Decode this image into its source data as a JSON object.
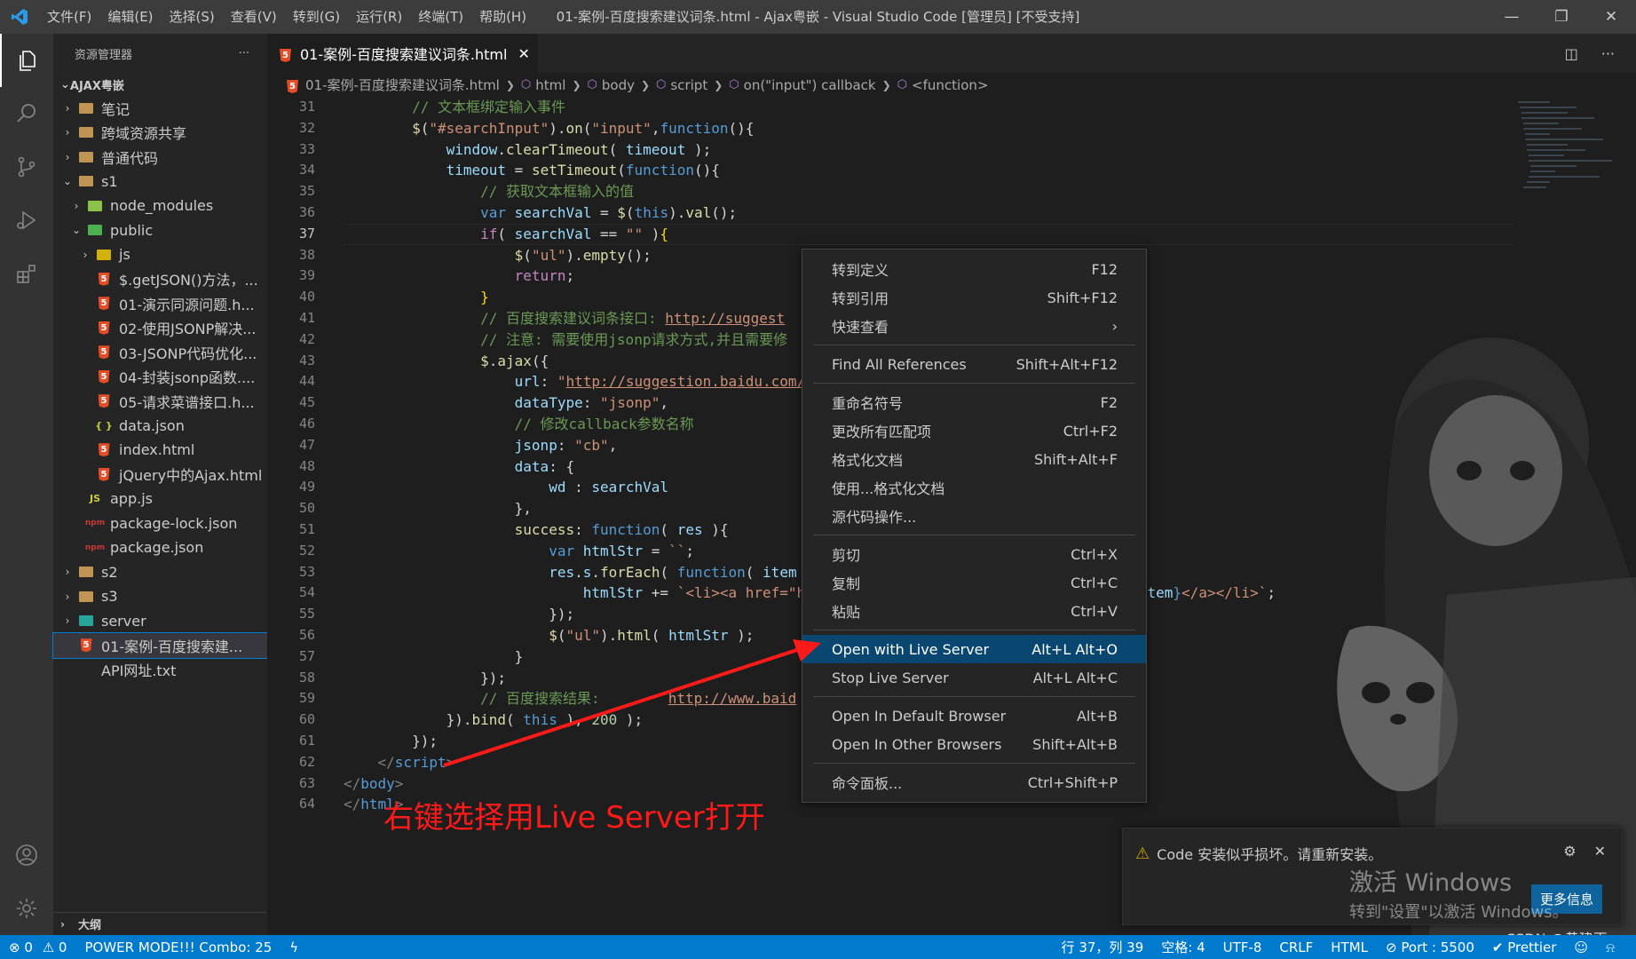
{
  "titlebar": {
    "menu": [
      "文件(F)",
      "编辑(E)",
      "选择(S)",
      "查看(V)",
      "转到(G)",
      "运行(R)",
      "终端(T)",
      "帮助(H)"
    ],
    "title": "01-案例-百度搜索建议词条.html - Ajax粤嵌 - Visual Studio Code [管理员] [不受支持]"
  },
  "sidebar": {
    "header": "资源管理器",
    "root": "AJAX粤嵌",
    "items": [
      {
        "label": "笔记",
        "type": "folder",
        "level": 1,
        "state": "closed"
      },
      {
        "label": "跨域资源共享",
        "type": "folder",
        "level": 1,
        "state": "closed"
      },
      {
        "label": "普通代码",
        "type": "folder",
        "level": 1,
        "state": "closed"
      },
      {
        "label": "s1",
        "type": "folder",
        "level": 1,
        "state": "open"
      },
      {
        "label": "node_modules",
        "type": "folder-node",
        "level": 2,
        "state": "closed"
      },
      {
        "label": "public",
        "type": "folder-public",
        "level": 2,
        "state": "open"
      },
      {
        "label": "js",
        "type": "folder-js",
        "level": 3,
        "state": "closed"
      },
      {
        "label": "$.getJSON()方法，...",
        "type": "html",
        "level": 3
      },
      {
        "label": "01-演示同源问题.h...",
        "type": "html",
        "level": 3
      },
      {
        "label": "02-使用JSONP解决...",
        "type": "html",
        "level": 3
      },
      {
        "label": "03-JSONP代码优化...",
        "type": "html",
        "level": 3
      },
      {
        "label": "04-封装jsonp函数....",
        "type": "html",
        "level": 3
      },
      {
        "label": "05-请求菜谱接口.h...",
        "type": "html",
        "level": 3
      },
      {
        "label": "data.json",
        "type": "json",
        "level": 3
      },
      {
        "label": "index.html",
        "type": "html",
        "level": 3
      },
      {
        "label": "jQuery中的Ajax.html",
        "type": "html",
        "level": 3
      },
      {
        "label": "app.js",
        "type": "js",
        "level": 2
      },
      {
        "label": "package-lock.json",
        "type": "npm",
        "level": 2
      },
      {
        "label": "package.json",
        "type": "npm",
        "level": 2
      },
      {
        "label": "s2",
        "type": "folder",
        "level": 1,
        "state": "closed"
      },
      {
        "label": "s3",
        "type": "folder",
        "level": 1,
        "state": "closed"
      },
      {
        "label": "server",
        "type": "folder-server",
        "level": 1,
        "state": "closed"
      },
      {
        "label": "01-案例-百度搜索建...",
        "type": "html",
        "level": 1,
        "selected": true
      },
      {
        "label": "API网址.txt",
        "type": "txt",
        "level": 1
      }
    ],
    "outline": "大纲"
  },
  "tab": {
    "label": "01-案例-百度搜索建议词条.html"
  },
  "breadcrumb": [
    "01-案例-百度搜索建议词条.html",
    "html",
    "body",
    "script",
    "on(\"input\") callback",
    "<function>"
  ],
  "editor": {
    "line_start": 31,
    "current_line": 37,
    "lines": [
      [
        [
          "c-com",
          "        // 文本框绑定输入事件"
        ]
      ],
      [
        [
          "",
          "        "
        ],
        [
          "c-fn",
          "$"
        ],
        [
          "",
          "("
        ],
        [
          "c-str",
          "\"#searchInput\""
        ],
        [
          "",
          ")."
        ],
        [
          "c-fn",
          "on"
        ],
        [
          "",
          "("
        ],
        [
          "c-str",
          "\"input\""
        ],
        [
          "",
          ","
        ],
        [
          "c-kw",
          "function"
        ],
        [
          "",
          "(){"
        ]
      ],
      [
        [
          "",
          "            "
        ],
        [
          "c-var",
          "window"
        ],
        [
          "",
          "."
        ],
        [
          "c-fn",
          "clearTimeout"
        ],
        [
          "",
          "( "
        ],
        [
          "c-var",
          "timeout"
        ],
        [
          "",
          " );"
        ]
      ],
      [
        [
          "",
          "            "
        ],
        [
          "c-var",
          "timeout"
        ],
        [
          "",
          " = "
        ],
        [
          "c-fn",
          "setTimeout"
        ],
        [
          "",
          "("
        ],
        [
          "c-kw",
          "function"
        ],
        [
          "",
          "(){"
        ]
      ],
      [
        [
          "c-com",
          "                // 获取文本框输入的值"
        ]
      ],
      [
        [
          "",
          "                "
        ],
        [
          "c-kw",
          "var"
        ],
        [
          "",
          " "
        ],
        [
          "c-var",
          "searchVal"
        ],
        [
          "",
          " = "
        ],
        [
          "c-fn",
          "$"
        ],
        [
          "",
          "("
        ],
        [
          "c-kw",
          "this"
        ],
        [
          "",
          ")."
        ],
        [
          "c-fn",
          "val"
        ],
        [
          "",
          "();"
        ]
      ],
      [
        [
          "",
          "                "
        ],
        [
          "c-ctl",
          "if"
        ],
        [
          "",
          "( "
        ],
        [
          "c-var",
          "searchVal"
        ],
        [
          "",
          " == "
        ],
        [
          "c-str",
          "\"\""
        ],
        [
          "",
          " )"
        ],
        [
          "c-br",
          "{"
        ]
      ],
      [
        [
          "",
          "                    "
        ],
        [
          "c-fn",
          "$"
        ],
        [
          "",
          "("
        ],
        [
          "c-str",
          "\"ul\""
        ],
        [
          "",
          ")."
        ],
        [
          "c-fn",
          "empty"
        ],
        [
          "",
          "();"
        ]
      ],
      [
        [
          "",
          "                    "
        ],
        [
          "c-ctl",
          "return"
        ],
        [
          "",
          ";"
        ]
      ],
      [
        [
          "",
          "                "
        ],
        [
          "c-br",
          "}"
        ]
      ],
      [
        [
          "c-com",
          "                // 百度搜索建议词条接口: "
        ],
        [
          "c-url",
          "http://suggest"
        ]
      ],
      [
        [
          "c-com",
          "                // 注意: 需要使用jsonp请求方式,并且需要修"
        ]
      ],
      [
        [
          "",
          "                "
        ],
        [
          "c-fn",
          "$"
        ],
        [
          "",
          "."
        ],
        [
          "c-fn",
          "ajax"
        ],
        [
          "",
          "({"
        ]
      ],
      [
        [
          "",
          "                    "
        ],
        [
          "c-var",
          "url"
        ],
        [
          "",
          ": "
        ],
        [
          "c-str",
          "\""
        ],
        [
          "c-url",
          "http://suggestion.baidu.com/"
        ]
      ],
      [
        [
          "",
          "                    "
        ],
        [
          "c-var",
          "dataType"
        ],
        [
          "",
          ": "
        ],
        [
          "c-str",
          "\"jsonp\""
        ],
        [
          "",
          ","
        ]
      ],
      [
        [
          "c-com",
          "                    // 修改callback参数名称"
        ]
      ],
      [
        [
          "",
          "                    "
        ],
        [
          "c-var",
          "jsonp"
        ],
        [
          "",
          ": "
        ],
        [
          "c-str",
          "\"cb\""
        ],
        [
          "",
          ","
        ]
      ],
      [
        [
          "",
          "                    "
        ],
        [
          "c-var",
          "data"
        ],
        [
          "",
          ": {"
        ]
      ],
      [
        [
          "",
          "                        "
        ],
        [
          "c-var",
          "wd"
        ],
        [
          "",
          " : "
        ],
        [
          "c-var",
          "searchVal"
        ]
      ],
      [
        [
          "",
          "                    },"
        ]
      ],
      [
        [
          "",
          "                    "
        ],
        [
          "c-fn",
          "success"
        ],
        [
          "",
          ": "
        ],
        [
          "c-kw",
          "function"
        ],
        [
          "",
          "( "
        ],
        [
          "c-var",
          "res"
        ],
        [
          "",
          " ){"
        ]
      ],
      [
        [
          "",
          "                        "
        ],
        [
          "c-kw",
          "var"
        ],
        [
          "",
          " "
        ],
        [
          "c-var",
          "htmlStr"
        ],
        [
          "",
          " = "
        ],
        [
          "c-str",
          "``"
        ],
        [
          "",
          ";"
        ]
      ],
      [
        [
          "",
          "                        "
        ],
        [
          "c-var",
          "res"
        ],
        [
          "",
          "."
        ],
        [
          "c-var",
          "s"
        ],
        [
          "",
          "."
        ],
        [
          "c-fn",
          "forEach"
        ],
        [
          "",
          "( "
        ],
        [
          "c-kw",
          "function"
        ],
        [
          "",
          "( "
        ],
        [
          "c-var",
          "item"
        ]
      ],
      [
        [
          "",
          "                            "
        ],
        [
          "c-var",
          "htmlStr"
        ],
        [
          "",
          " += "
        ],
        [
          "c-str",
          "`<li><a href=\"h"
        ],
        [
          "",
          "                          "
        ],
        [
          "c-str",
          "t=\"_blank\">"
        ],
        [
          "c-kw",
          "${"
        ],
        [
          "c-var",
          "item"
        ],
        [
          "c-kw",
          "}"
        ],
        [
          "c-str",
          "</a></li>`"
        ],
        [
          "",
          ";"
        ]
      ],
      [
        [
          "",
          "                        });"
        ]
      ],
      [
        [
          "",
          "                        "
        ],
        [
          "c-fn",
          "$"
        ],
        [
          "",
          "("
        ],
        [
          "c-str",
          "\"ul\""
        ],
        [
          "",
          ")."
        ],
        [
          "c-fn",
          "html"
        ],
        [
          "",
          "( "
        ],
        [
          "c-var",
          "htmlStr"
        ],
        [
          "",
          " );"
        ]
      ],
      [
        [
          "",
          "                    }"
        ]
      ],
      [
        [
          "",
          "                });"
        ]
      ],
      [
        [
          "c-com",
          "                // 百度搜索结果:        "
        ],
        [
          "c-url",
          "http://www.baid"
        ]
      ],
      [
        [
          "",
          "            })."
        ],
        [
          "c-fn",
          "bind"
        ],
        [
          "",
          "( "
        ],
        [
          "c-kw",
          "this"
        ],
        [
          "",
          " ), "
        ],
        [
          "c-num",
          "200"
        ],
        [
          "",
          " );"
        ]
      ],
      [
        [
          "",
          "        });"
        ]
      ],
      [
        [
          "",
          "    "
        ],
        [
          "c-gray",
          "</"
        ],
        [
          "c-tag",
          "script"
        ],
        [
          "c-gray",
          ">"
        ]
      ],
      [
        [
          "c-gray",
          "</"
        ],
        [
          "c-tag",
          "body"
        ],
        [
          "c-gray",
          ">"
        ]
      ],
      [
        [
          "c-gray",
          "</"
        ],
        [
          "c-tag",
          "html"
        ],
        [
          "c-gray",
          ">"
        ]
      ]
    ]
  },
  "context_menu": [
    {
      "label": "转到定义",
      "kb": "F12"
    },
    {
      "label": "转到引用",
      "kb": "Shift+F12"
    },
    {
      "label": "快速查看",
      "kb": "›"
    },
    {
      "sep": true
    },
    {
      "label": "Find All References",
      "kb": "Shift+Alt+F12"
    },
    {
      "sep": true
    },
    {
      "label": "重命名符号",
      "kb": "F2"
    },
    {
      "label": "更改所有匹配项",
      "kb": "Ctrl+F2"
    },
    {
      "label": "格式化文档",
      "kb": "Shift+Alt+F"
    },
    {
      "label": "使用...格式化文档",
      "kb": ""
    },
    {
      "label": "源代码操作...",
      "kb": ""
    },
    {
      "sep": true
    },
    {
      "label": "剪切",
      "kb": "Ctrl+X"
    },
    {
      "label": "复制",
      "kb": "Ctrl+C"
    },
    {
      "label": "粘贴",
      "kb": "Ctrl+V"
    },
    {
      "sep": true
    },
    {
      "label": "Open with Live Server",
      "kb": "Alt+L Alt+O",
      "active": true
    },
    {
      "label": "Stop Live Server",
      "kb": "Alt+L Alt+C"
    },
    {
      "sep": true
    },
    {
      "label": "Open In Default Browser",
      "kb": "Alt+B"
    },
    {
      "label": "Open In Other Browsers",
      "kb": "Shift+Alt+B"
    },
    {
      "sep": true
    },
    {
      "label": "命令面板...",
      "kb": "Ctrl+Shift+P"
    }
  ],
  "annotation": "右键选择用Live Server打开",
  "notification": {
    "message": "Code 安装似乎损坏。请重新安装。",
    "button": "更多信息"
  },
  "watermark": {
    "line1": "激活 Windows",
    "line2": "转到\"设置\"以激活 Windows。"
  },
  "csdn": "CSDN @黄建再",
  "statusbar": {
    "errors": "0",
    "warnings": "0",
    "power_mode": "POWER MODE!!! Combo: 25",
    "position": "行 37，列 39",
    "spaces": "空格: 4",
    "encoding": "UTF-8",
    "eol": "CRLF",
    "language": "HTML",
    "port": "Port : 5500",
    "prettier": "Prettier"
  },
  "colors": {
    "accent": "#007acc",
    "annotation": "#ff1a1a",
    "menu_active": "#094771"
  }
}
